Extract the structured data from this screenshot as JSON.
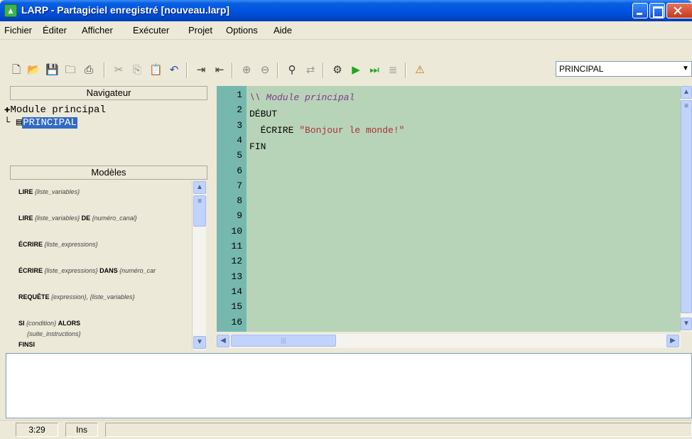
{
  "window": {
    "title": "LARP - Partagiciel enregistré [nouveau.larp]",
    "app_icon": "larp-icon"
  },
  "menu": [
    "Fichier",
    "Éditer",
    "Afficher",
    "Exécuter",
    "Projet",
    "Options",
    "Aide"
  ],
  "toolbar": {
    "icons": [
      "new-file-icon",
      "open-file-icon",
      "save-file-icon",
      "open-folder-icon",
      "print-icon",
      "cut-icon",
      "copy-icon",
      "paste-icon",
      "undo-icon",
      "indent-icon",
      "outdent-icon",
      "zoom-in-icon",
      "zoom-out-icon",
      "find-icon",
      "replace-icon",
      "compile-icon",
      "run-icon",
      "step-icon",
      "text-icon",
      "debug-icon"
    ],
    "module_select": "PRINCIPAL"
  },
  "navigator": {
    "header": "Navigateur",
    "root": "Module principal",
    "selected": "PRINCIPAL"
  },
  "models": {
    "header": "Modèles",
    "items": [
      {
        "kw": "LIRE",
        "arg": "{liste_variables}"
      },
      {
        "kw": "LIRE",
        "arg": "{liste_variables}",
        "kw2": "DE",
        "arg2": "{numéro_canal}"
      },
      {
        "kw": "ÉCRIRE",
        "arg": "{liste_expressions}"
      },
      {
        "kw": "ÉCRIRE",
        "arg": "{liste_expressions}",
        "kw2": "DANS",
        "arg2": "{numéro_car"
      },
      {
        "kw": "REQUÊTE",
        "arg": "{expression}, {liste_variables}"
      },
      {
        "kw": "SI",
        "arg": "{condition}",
        "kw2": "ALORS",
        "arg2": ""
      },
      {
        "kw": "",
        "arg": "{suite_instructions}"
      },
      {
        "kw": "FINSI",
        "arg": ""
      }
    ]
  },
  "editor": {
    "line_numbers": [
      "1",
      "2",
      "3",
      "4",
      "5",
      "6",
      "7",
      "8",
      "9",
      "10",
      "11",
      "12",
      "13",
      "14",
      "15",
      "16"
    ],
    "lines": [
      {
        "t": "\\\\ Module principal",
        "kind": "comment"
      },
      {
        "t": "DÉBUT",
        "kind": "code"
      },
      {
        "t": "  ÉCRIRE ",
        "str": "\"Bonjour le monde!\"",
        "kind": "mixed"
      },
      {
        "t": "FIN",
        "kind": "code"
      }
    ]
  },
  "status": {
    "position": "3:29",
    "mode": "Ins"
  },
  "colors": {
    "editor_bg": "#b8d4b8",
    "gutter_bg": "#76b8ae",
    "comment": "#7b3a8c",
    "string": "#a83232",
    "selection": "#316ac5"
  }
}
